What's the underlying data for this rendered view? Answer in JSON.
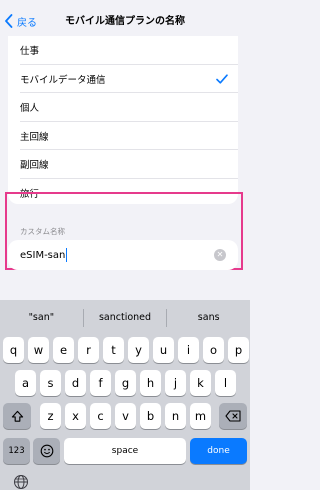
{
  "nav": {
    "back_label": "戻る",
    "title": "モバイル通信プランの名称"
  },
  "options": [
    {
      "label": "仕事",
      "selected": false
    },
    {
      "label": "モバイルデータ通信",
      "selected": true
    },
    {
      "label": "個人",
      "selected": false
    },
    {
      "label": "主回線",
      "selected": false
    },
    {
      "label": "副回線",
      "selected": false
    },
    {
      "label": "旅行",
      "selected": false
    }
  ],
  "custom": {
    "section_label": "カスタム名称",
    "value": "eSIM-san"
  },
  "keyboard": {
    "suggestions": [
      "\"san\"",
      "sanctioned",
      "sans"
    ],
    "row1": [
      "q",
      "w",
      "e",
      "r",
      "t",
      "y",
      "u",
      "i",
      "o",
      "p"
    ],
    "row2": [
      "a",
      "s",
      "d",
      "f",
      "g",
      "h",
      "j",
      "k",
      "l"
    ],
    "row3": [
      "z",
      "x",
      "c",
      "v",
      "b",
      "n",
      "m"
    ],
    "numbers_label": "123",
    "space_label": "space",
    "done_label": "done"
  },
  "colors": {
    "accent": "#0a7aff",
    "highlight": "#e63a8c"
  }
}
